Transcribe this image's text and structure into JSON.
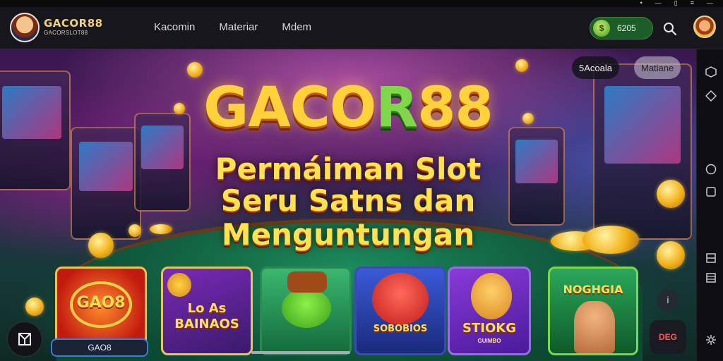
{
  "header": {
    "brand": "GACOR88",
    "brand_sub": "GACORSLOT88",
    "nav": [
      {
        "label": "Kacomin"
      },
      {
        "label": "Materiar"
      },
      {
        "label": "Mdem"
      }
    ],
    "balance": {
      "value": "6205",
      "icon": "coin-icon"
    },
    "search_icon": "search-icon",
    "avatar_icon": "avatar"
  },
  "hero": {
    "title_part1": "GACO",
    "title_part2": "R",
    "title_part3": "88",
    "subtitle_line1": "Permáiman Slot",
    "subtitle_line2": "Seru Satns dan",
    "subtitle_line3": "Menguntungan",
    "chip_left": "5Acoala",
    "chip_right": "Matiane"
  },
  "games": [
    {
      "label": "GAO8",
      "caption": "GAO8"
    },
    {
      "label": "Lo As\nBAINAOS"
    },
    {
      "label": ""
    },
    {
      "label": "SOBOBIOS"
    },
    {
      "label": "STIOKG",
      "sublabel": "GUIMBO"
    },
    {
      "label": "NOGHGIA"
    }
  ],
  "misc": {
    "dec_badge": "DEG",
    "mini_badge": "i"
  },
  "colors": {
    "accent_gold": "#ffd23a",
    "accent_green": "#7ed84a",
    "balance_green": "#1e5c2a",
    "header_bg": "#16161c"
  }
}
